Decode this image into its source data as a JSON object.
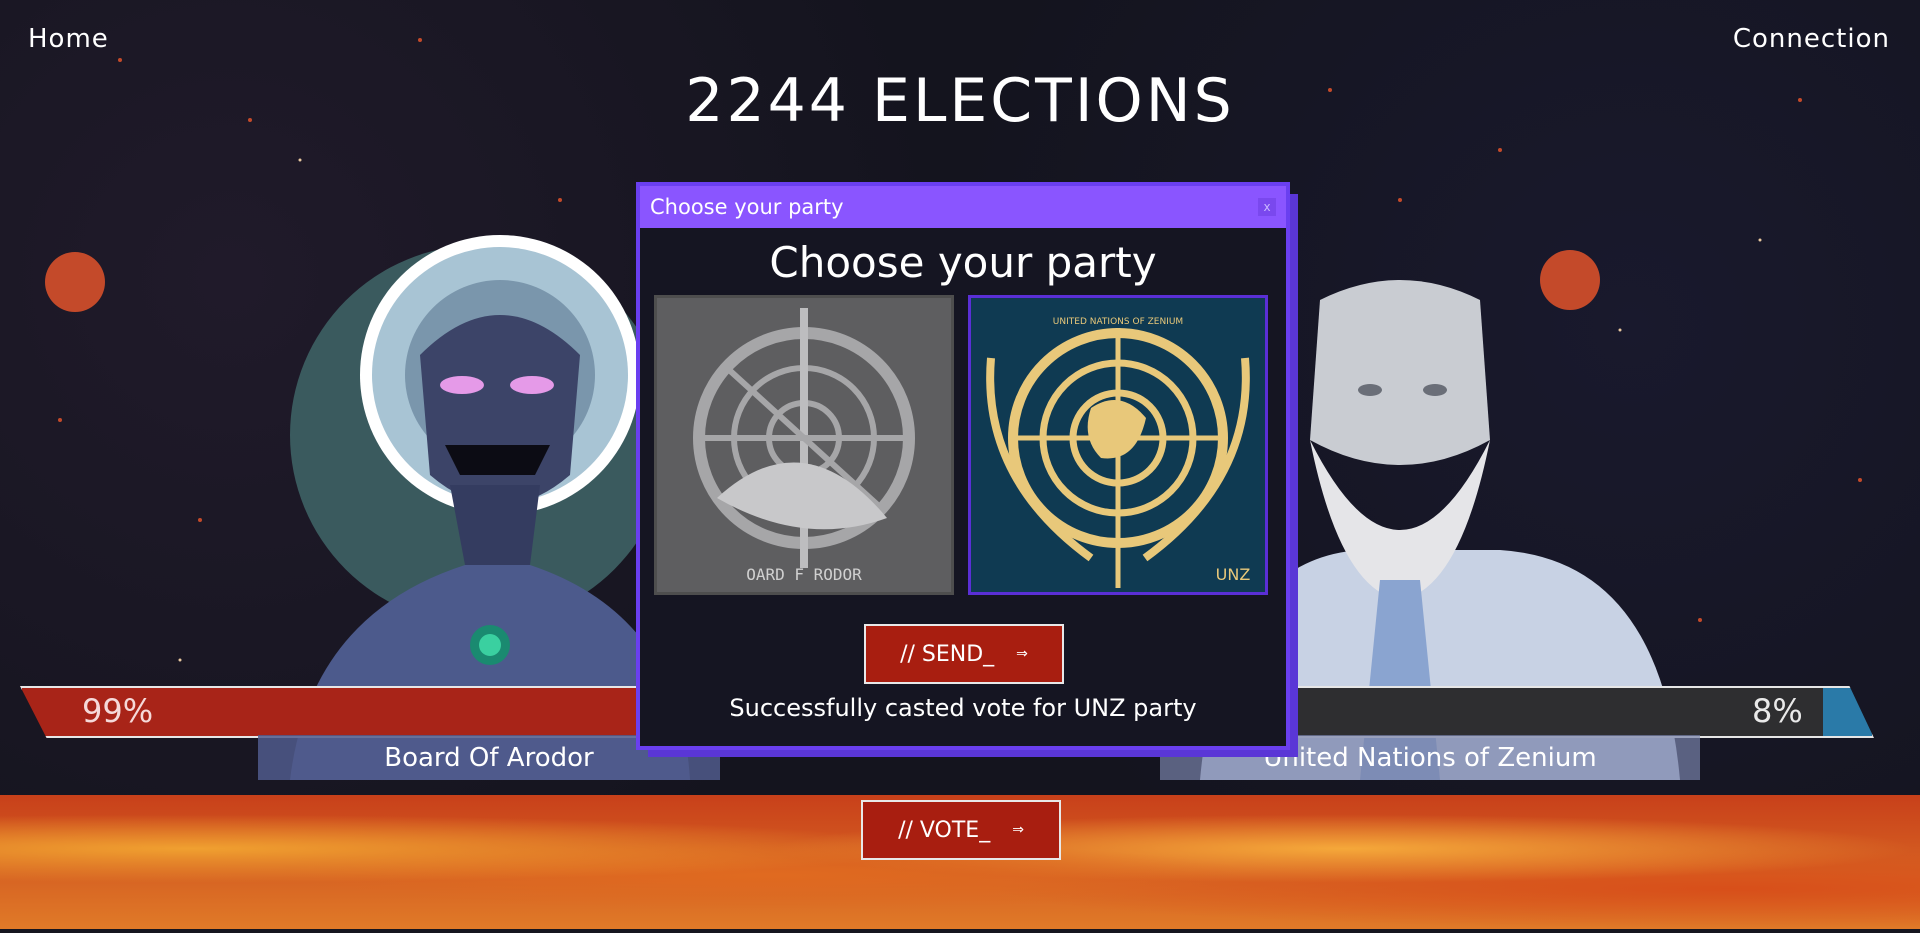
{
  "nav": {
    "home": "Home",
    "connection": "Connection"
  },
  "title": "2244 ELECTIONS",
  "candidates": [
    {
      "name": "Board Of Arodor",
      "percent": "99%",
      "share": 0.92,
      "color": "#a82418"
    },
    {
      "name": "United Nations of Zenium",
      "percent": "8%",
      "share": 0.08,
      "color": "#2a7aa8"
    }
  ],
  "buttons": {
    "vote": "// VOTE_",
    "send": "// SEND_",
    "arrow": "⇒"
  },
  "modal": {
    "header_title": "Choose your party",
    "close": "x",
    "heading": "Choose your party",
    "parties": [
      {
        "emblem_text": "OARD F RODOR",
        "selected": false
      },
      {
        "emblem_text": "UNITED NATIONS OF ZENIUM",
        "badge": "UNZ",
        "selected": true
      }
    ],
    "status": "Successfully casted vote for UNZ party"
  },
  "icons": {
    "close": "close-icon",
    "arrow": "arrow-right-icon"
  }
}
